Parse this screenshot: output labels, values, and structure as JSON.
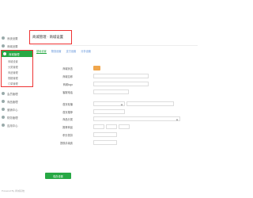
{
  "sidebar": {
    "items": [
      {
        "label": "系统设置"
      },
      {
        "label": "商城设置"
      },
      {
        "label": "会员管理"
      },
      {
        "label": "商品管理"
      },
      {
        "label": "营销中心"
      },
      {
        "label": "财务管理"
      },
      {
        "label": "应用中心"
      }
    ],
    "active_label": "商城管理",
    "sub_items": [
      "商城设置",
      "分类管理",
      "商品管理",
      "规格管理",
      "订单管理"
    ]
  },
  "header": {
    "title": "商城管理 · 商城设置"
  },
  "tabs": [
    "基础设置",
    "物流设置",
    "支付设置",
    "分享设置"
  ],
  "form": {
    "rows": [
      {
        "label": "商城状态"
      },
      {
        "label": "商城名称"
      },
      {
        "label": "商城logo"
      },
      {
        "label": "客服电话"
      },
      {
        "label": "首页轮播"
      },
      {
        "label": "首页推荐"
      },
      {
        "label": "商品分类"
      },
      {
        "label": "推荐商品"
      },
      {
        "label": "积分抵扣"
      },
      {
        "label": "提现手续费"
      }
    ]
  },
  "save_button": "保存设置",
  "footer": "Powered By 商城系统"
}
